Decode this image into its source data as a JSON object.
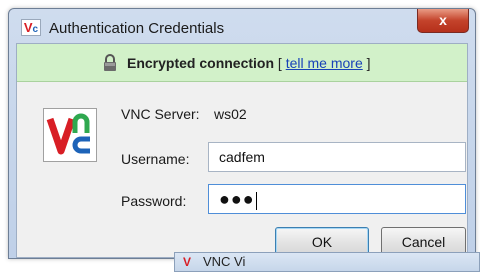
{
  "window": {
    "title": "Authentication Credentials",
    "app_icon": "vnc-icon",
    "close_label": "x"
  },
  "banner": {
    "icon": "lock-icon",
    "text": "Encrypted connection",
    "bracket_open": "[",
    "link": "tell me more",
    "bracket_close": "]"
  },
  "form": {
    "server_label": "VNC Server:",
    "server_value": "ws02",
    "username_label": "Username:",
    "username_value": "cadfem",
    "password_label": "Password:",
    "password_value": "●●●"
  },
  "buttons": {
    "ok": "OK",
    "cancel": "Cancel"
  },
  "background_window": {
    "title": "VNC Vi"
  },
  "colors": {
    "banner_bg": "#d2f1c9",
    "vnc_red": "#d81e25",
    "vnc_blue": "#1d63b8",
    "close_red": "#c4432b"
  }
}
